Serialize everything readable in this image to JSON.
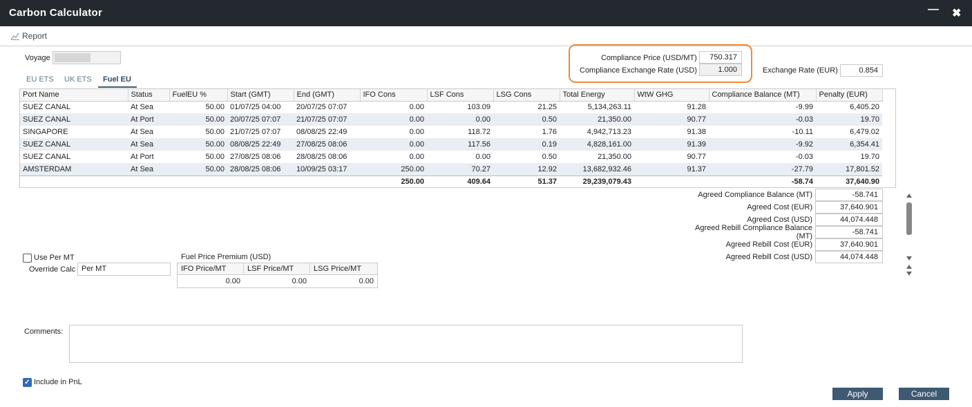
{
  "window": {
    "title": "Carbon Calculator"
  },
  "toolbar": {
    "report_label": "Report"
  },
  "voyage": {
    "label": "Voyage",
    "value": ""
  },
  "compliance": {
    "price_label": "Compliance Price (USD/MT)",
    "price_value": "750.317",
    "exchange_label": "Compliance Exchange Rate (USD)",
    "exchange_value": "1.000"
  },
  "exchange_rate": {
    "label": "Exchange Rate (EUR)",
    "value": "0.854"
  },
  "tabs": [
    "EU ETS",
    "UK ETS",
    "Fuel EU"
  ],
  "active_tab": "Fuel EU",
  "grid": {
    "columns": [
      "Port Name",
      "Status",
      "FuelEU %",
      "Start (GMT)",
      "End (GMT)",
      "IFO Cons",
      "LSF Cons",
      "LSG Cons",
      "Total Energy",
      "WtW GHG",
      "Compliance Balance (MT)",
      "Penalty (EUR)"
    ],
    "rows": [
      [
        "SUEZ CANAL",
        "At Sea",
        "50.00",
        "01/07/25 04:00",
        "20/07/25 07:07",
        "0.00",
        "103.09",
        "21.25",
        "5,134,263.11",
        "91.28",
        "-9.99",
        "6,405.20"
      ],
      [
        "SUEZ CANAL",
        "At Port",
        "50.00",
        "20/07/25 07:07",
        "21/07/25 07:07",
        "0.00",
        "0.00",
        "0.50",
        "21,350.00",
        "90.77",
        "-0.03",
        "19.70"
      ],
      [
        "SINGAPORE",
        "At Sea",
        "50.00",
        "21/07/25 07:07",
        "08/08/25 22:49",
        "0.00",
        "118.72",
        "1.76",
        "4,942,713.23",
        "91.38",
        "-10.11",
        "6,479.02"
      ],
      [
        "SUEZ CANAL",
        "At Sea",
        "50.00",
        "08/08/25 22:49",
        "27/08/25 08:06",
        "0.00",
        "117.56",
        "0.19",
        "4,828,161.00",
        "91.39",
        "-9.92",
        "6,354.41"
      ],
      [
        "SUEZ CANAL",
        "At Port",
        "50.00",
        "27/08/25 08:06",
        "28/08/25 08:06",
        "0.00",
        "0.00",
        "0.50",
        "21,350.00",
        "90.77",
        "-0.03",
        "19.70"
      ],
      [
        "AMSTERDAM",
        "At Sea",
        "50.00",
        "28/08/25 08:06",
        "10/09/25 03:17",
        "250.00",
        "70.27",
        "12.92",
        "13,682,932.46",
        "91.37",
        "-27.79",
        "17,801.52"
      ]
    ],
    "totals": [
      "",
      "",
      "",
      "",
      "",
      "250.00",
      "409.64",
      "51.37",
      "29,239,079.43",
      "",
      "-58.74",
      "37,640.90"
    ]
  },
  "agreed": [
    {
      "label": "Agreed Compliance Balance (MT)",
      "value": "-58.741"
    },
    {
      "label": "Agreed Cost (EUR)",
      "value": "37,640.901"
    },
    {
      "label": "Agreed Cost (USD)",
      "value": "44,074.448"
    },
    {
      "label": "Agreed Rebill Compliance Balance (MT)",
      "value": "-58.741"
    },
    {
      "label": "Agreed Rebill Cost (EUR)",
      "value": "37,640.901"
    },
    {
      "label": "Agreed Rebill Cost (USD)",
      "value": "44,074.448"
    }
  ],
  "per_mt": {
    "checkbox_label": "Use Per MT",
    "checked": false,
    "override_label": "Override Calc",
    "override_value": "Per MT"
  },
  "fuel_price_premium": {
    "title": "Fuel Price Premium (USD)",
    "headers": [
      "IFO Price/MT",
      "LSF Price/MT",
      "LSG Price/MT"
    ],
    "values": [
      "0.00",
      "0.00",
      "0.00"
    ]
  },
  "comments": {
    "label": "Comments:",
    "value": ""
  },
  "include_pnl": {
    "label": "Include in PnL",
    "checked": true
  },
  "buttons": {
    "apply": "Apply",
    "cancel": "Cancel"
  },
  "colors": {
    "titlebar": "#23292f",
    "button": "#3e5a72",
    "highlight": "#f08a3c",
    "row_alt": "#e8eef4"
  }
}
